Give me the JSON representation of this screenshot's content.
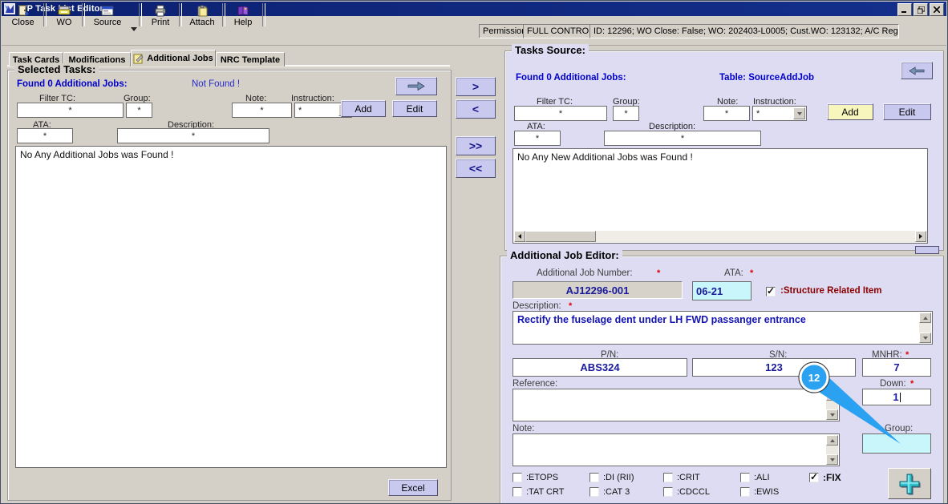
{
  "colors": {
    "titlebar_blue": "#0c2070",
    "window_gray": "#d4d0c8",
    "panel_lavender": "#dedcf2",
    "button_lavender": "#c9c8ef",
    "button_yellow": "#f7f6bd",
    "input_cyan": "#c8f6fa",
    "link_blue": "#0000cc",
    "value_blue": "#1a1a9c",
    "maroon": "#8b0000",
    "annotation_blue": "#2aa1f1"
  },
  "window": {
    "title": "WP Task List Editor"
  },
  "toolbar": {
    "buttons": [
      {
        "label": "Close",
        "icon": "exit-door-icon"
      },
      {
        "label": "WO",
        "icon": "wo-machine-icon"
      },
      {
        "label": "Source",
        "icon": "source-window-icon"
      },
      {
        "label": "Print",
        "icon": "printer-icon"
      },
      {
        "label": "Attach",
        "icon": "attach-clipboard-icon"
      },
      {
        "label": "Help",
        "icon": "help-book-icon"
      }
    ],
    "permission_label": "Permission:",
    "permission_value": "FULL CONTROL",
    "info": "ID: 12296; WO Close: False; WO: 202403-L0005; Cust.WO: 123132; A/C Reg: EI-GXO"
  },
  "tabs": {
    "items": [
      {
        "label": "Task Cards",
        "active": false
      },
      {
        "label": "Modifications",
        "active": false
      },
      {
        "label": "Additional Jobs",
        "active": true
      },
      {
        "label": "NRC Template",
        "active": false
      }
    ]
  },
  "selected_tasks": {
    "title": "Selected Tasks:",
    "found": "Found 0 Additional Jobs:",
    "status": "Not Found !",
    "filter": {
      "tc_label": "Filter TC:",
      "tc_value": "*",
      "group_label": "Group:",
      "group_value": "*",
      "note_label": "Note:",
      "note_value": "*",
      "instruction_label": "Instruction:",
      "instruction_value": "*",
      "ata_label": "ATA:",
      "ata_value": "*",
      "desc_label": "Description:",
      "desc_value": "*"
    },
    "add": "Add",
    "edit": "Edit",
    "list_message": "No Any Additional Jobs was Found !",
    "excel": "Excel"
  },
  "transfer": {
    "move_right": ">",
    "move_left": "<",
    "move_all_right": ">>",
    "move_all_left": "<<"
  },
  "tasks_source": {
    "title": "Tasks Source:",
    "found": "Found 0 Additional Jobs:",
    "table": "Table: SourceAddJob",
    "filter": {
      "tc_label": "Filter TC:",
      "tc_value": "*",
      "group_label": "Group:",
      "group_value": "*",
      "note_label": "Note:",
      "note_value": "*",
      "instruction_label": "Instruction:",
      "instruction_value": "*",
      "ata_label": "ATA:",
      "ata_value": "*",
      "desc_label": "Description:",
      "desc_value": "*"
    },
    "add": "Add",
    "edit": "Edit",
    "list_message": "No Any New Additional Jobs was Found !"
  },
  "job_editor": {
    "title": "Additional Job Editor:",
    "required_marker": "*",
    "job_number_label": "Additional Job Number:",
    "job_number_value": "AJ12296-001",
    "ata_label": "ATA:",
    "ata_value": "06-21",
    "structure_label": ":Structure Related Item",
    "structure_checked": true,
    "description_label": "Description:",
    "description_value": "Rectify the fuselage dent under LH FWD passanger entrance",
    "pn_label": "P/N:",
    "pn_value": "ABS324",
    "sn_label": "S/N:",
    "sn_value": "123",
    "mnhr_label": "MNHR:",
    "mnhr_value": "7",
    "reference_label": "Reference:",
    "reference_value": "",
    "down_label": "Down:",
    "down_value": "1",
    "note_label": "Note:",
    "note_value": "",
    "group_label": "Group:",
    "group_value": "",
    "flags_row1": [
      {
        "label": ":ETOPS",
        "checked": false
      },
      {
        "label": ":DI (RII)",
        "checked": false
      },
      {
        "label": ":CRIT",
        "checked": false
      },
      {
        "label": ":ALI",
        "checked": false
      },
      {
        "label": ":FIX",
        "checked": true
      }
    ],
    "flags_row2": [
      {
        "label": ":TAT CRT",
        "checked": false
      },
      {
        "label": ":CAT 3",
        "checked": false
      },
      {
        "label": ":CDCCL",
        "checked": false
      },
      {
        "label": ":EWIS",
        "checked": false
      }
    ]
  },
  "annotation": {
    "step": "12"
  }
}
